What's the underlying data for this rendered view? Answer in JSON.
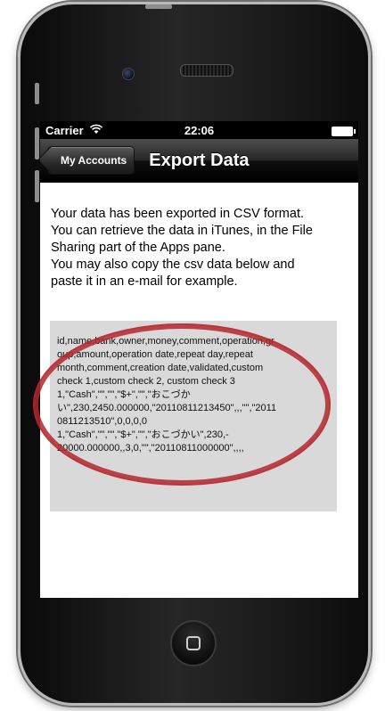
{
  "status_bar": {
    "carrier": "Carrier",
    "wifi_icon": "wifi-icon",
    "time": "22:06",
    "battery_icon": "battery-icon"
  },
  "nav_bar": {
    "back_button_label": "My Accounts",
    "title": "Export Data"
  },
  "main": {
    "message_lines": [
      "Your data has been exported in CSV format.",
      "You can retrieve the data in iTunes, in the File",
      "Sharing part of the Apps pane.",
      "You may also copy the csv data below and",
      "paste it in an e-mail for example."
    ],
    "csv_text": "id,name,bank,owner,money,comment,operation,gr\noup,amount,operation date,repeat day,repeat\nmonth,comment,creation date,validated,custom\ncheck 1,custom check 2, custom check 3\n1,\"Cash\",\"\",\"\",\"$+\",\"\",\"おこづか\nい\",230,2450.000000,\"20110811213450\",,,\"\",\"2011\n0811213510\",0,0,0,0\n1,\"Cash\",\"\",\"\",\"$+\",\"\",\"おこづかい\",230,-\n20000.000000,,3,0,\"\",\"20110811000000\",,,,"
  },
  "annotation": {
    "color": "#b5262e"
  },
  "device": {
    "home_button_icon": "home-square-icon"
  }
}
